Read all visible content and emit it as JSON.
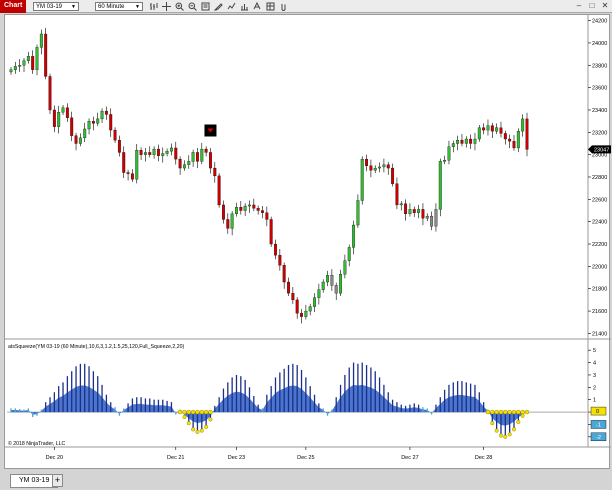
{
  "window": {
    "title": "Chart",
    "instrument": "YM 03-19",
    "interval": "60 Minute",
    "tab_label": "YM 03-19",
    "add_tab_label": "+"
  },
  "toolbar": {
    "buttons": [
      "bars-icon",
      "crosshair-icon",
      "zoom-in-icon",
      "zoom-out-icon",
      "properties-icon",
      "drawing-icon",
      "indicators-icon",
      "strategies-icon",
      "templates-icon",
      "data-box-icon",
      "attach-icon"
    ]
  },
  "colors": {
    "up": "#33bb33",
    "down": "#cc0000",
    "neutral": "#888888",
    "wick": "#000000",
    "hist_dark": "#1c2e8c",
    "hist_fill": "#2a5fc4",
    "hist_light": "#4aa8d8",
    "squeeze_on": "#f5e000",
    "price_marker": "#000000"
  },
  "price_panel": {
    "axis_labels": [
      "24200",
      "24000",
      "23800",
      "23600",
      "23400",
      "23200",
      "23000",
      "22800",
      "22600",
      "22400",
      "22200",
      "22000",
      "21800",
      "21600",
      "21400"
    ],
    "current_price_label": "23047",
    "current_price": 23047
  },
  "indicator_panel": {
    "title": "atsSqueeze(YM 03-19 (60 Minute),10,6,3,1.2,1.5,25,120,Full_Squeeze,2,20)",
    "axis_labels": [
      "5",
      "4",
      "3",
      "2",
      "1",
      "0",
      "-1",
      "-2"
    ],
    "marker_labels": [
      "0",
      "-1",
      "-2"
    ],
    "copyright": "© 2018 NinjaTrader, LLC"
  },
  "x_axis": {
    "labels": [
      "Dec 20",
      "Dec 21",
      "Dec 23",
      "Dec 25",
      "Dec 27",
      "Dec 28"
    ]
  },
  "chart_data": [
    {
      "type": "candlestick",
      "title": "",
      "xlabel": "",
      "ylabel": "",
      "ylim": [
        21350,
        24250
      ],
      "closes": [
        23760,
        23790,
        23800,
        23840,
        23880,
        23760,
        23960,
        24080,
        23700,
        23400,
        23250,
        23380,
        23420,
        23330,
        23170,
        23100,
        23150,
        23230,
        23300,
        23280,
        23320,
        23390,
        23360,
        23220,
        23130,
        23020,
        22840,
        22830,
        22780,
        23040,
        23000,
        23020,
        23000,
        23050,
        22990,
        23010,
        23030,
        23060,
        22960,
        22880,
        22910,
        22940,
        23020,
        22940,
        23050,
        23020,
        22880,
        22810,
        22550,
        22420,
        22340,
        22470,
        22530,
        22500,
        22540,
        22550,
        22520,
        22500,
        22480,
        22420,
        22200,
        22100,
        22010,
        21860,
        21760,
        21700,
        21580,
        21550,
        21600,
        21640,
        21720,
        21790,
        21860,
        21920,
        21830,
        21760,
        21930,
        22050,
        22170,
        22370,
        22590,
        22960,
        22900,
        22860,
        22880,
        22890,
        22910,
        22880,
        22740,
        22550,
        22560,
        22470,
        22510,
        22480,
        22510,
        22430,
        22450,
        22360,
        22510,
        22940,
        22950,
        23070,
        23100,
        23130,
        23100,
        23140,
        23100,
        23140,
        23240,
        23220,
        23260,
        23210,
        23240,
        23190,
        23140,
        23120,
        23060,
        23210,
        23320,
        23047
      ],
      "indicator_ylim": [
        -2.5,
        5.5
      ],
      "squeeze_histogram": [
        0.3,
        0.3,
        0.25,
        0.2,
        0.3,
        -0.4,
        -0.3,
        0.2,
        0.8,
        1.2,
        1.6,
        2.1,
        2.4,
        2.9,
        3.3,
        3.7,
        3.9,
        3.9,
        3.7,
        3.3,
        2.9,
        2.2,
        1.4,
        0.8,
        0.4,
        -0.3,
        0.3,
        0.7,
        1.1,
        1.2,
        1.2,
        1.1,
        1.1,
        1.0,
        1.0,
        1.0,
        0.9,
        0.8,
        -0.2,
        0.2,
        -0.4,
        -0.9,
        -1.4,
        -1.6,
        -1.5,
        -1.2,
        -0.6,
        0.5,
        1.2,
        1.9,
        2.4,
        2.8,
        3.0,
        2.9,
        2.6,
        2.0,
        1.3,
        0.6,
        0.3,
        1.4,
        2.1,
        2.8,
        3.2,
        3.5,
        3.8,
        3.9,
        3.8,
        3.4,
        2.8,
        2.1,
        1.4,
        0.7,
        0.3,
        -0.3,
        0.2,
        1.2,
        2.2,
        3.0,
        3.6,
        4.0,
        3.9,
        4.0,
        3.8,
        3.6,
        3.3,
        2.8,
        2.2,
        1.6,
        1.0,
        0.8,
        0.6,
        0.5,
        0.6,
        0.7,
        0.6,
        0.4,
        0.3,
        -0.2,
        0.6,
        1.2,
        1.8,
        2.2,
        2.4,
        2.5,
        2.5,
        2.4,
        2.3,
        2.2,
        1.6,
        0.8,
        0.2,
        -0.9,
        -1.5,
        -1.9,
        -2.0,
        -1.8,
        -1.4,
        -0.8,
        -0.3,
        0.1
      ],
      "squeeze_on_ranges": [
        [
          39,
          46
        ],
        [
          110,
          119
        ]
      ]
    }
  ]
}
